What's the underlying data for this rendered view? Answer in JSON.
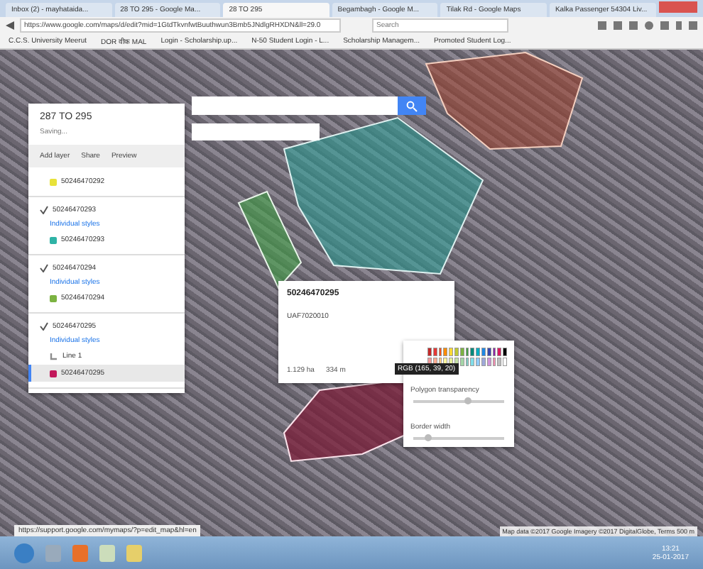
{
  "tabs": [
    {
      "label": "Inbox (2) - mayhataida...",
      "selected": false
    },
    {
      "label": "28 TO 295 - Google Ma...",
      "selected": false
    },
    {
      "label": "28 TO 295",
      "selected": true
    },
    {
      "label": "Begambagh - Google M...",
      "selected": false
    },
    {
      "label": "Tilak Rd - Google Maps",
      "selected": false
    },
    {
      "label": "Kalka Passenger 54304 Liv...",
      "selected": false
    }
  ],
  "address_bar": {
    "url": "https://www.google.com/maps/d/edit?mid=1GtdTkvnfwtBuuthwun3Bmb5JNdlgRHXDN&ll=29.0",
    "search_placeholder": "Search"
  },
  "bookmarks": [
    "C.C.S. University Meerut",
    "DOR वीक MAL",
    "Login - Scholarship.up...",
    "N-50 Student Login - L...",
    "Scholarship Managem...",
    "Promoted Student Log..."
  ],
  "map_panel": {
    "title": "287 TO 295",
    "status": "Saving...",
    "actions": [
      "Add layer",
      "Share",
      "Preview"
    ],
    "layers": [
      {
        "features": [
          {
            "label": "50246470292",
            "kind": "polygon",
            "color": "#e8e23a",
            "selected": false
          }
        ]
      },
      {
        "name": "50246470293",
        "checked": true,
        "style": "Individual styles",
        "features": [
          {
            "label": "50246470293",
            "kind": "polygon",
            "color": "#2fb3a6",
            "selected": false
          }
        ]
      },
      {
        "name": "50246470294",
        "checked": true,
        "style": "Individual styles",
        "features": [
          {
            "label": "50246470294",
            "kind": "polygon",
            "color": "#7cb342",
            "selected": false
          }
        ]
      },
      {
        "name": "50246470295",
        "checked": true,
        "style": "Individual styles",
        "features": [
          {
            "label": "Line 1",
            "kind": "line",
            "color": "#8d8d8d",
            "selected": false
          },
          {
            "label": "50246470295",
            "kind": "polygon",
            "color": "#c2185b",
            "selected": true
          }
        ]
      }
    ]
  },
  "info_popup": {
    "title": "50246470295",
    "description": "UAF7020010",
    "area": "1.129 ha",
    "perimeter": "334 m"
  },
  "color_picker": {
    "tooltip": "RGB (165, 39, 20)",
    "sliders": [
      {
        "label": "Polygon transparency",
        "level": 0.6
      },
      {
        "label": "Border width",
        "level": 0.15
      }
    ]
  },
  "status_link": "https://support.google.com/mymaps/?p=edit_map&hl=en",
  "map_credits": "Map data ©2017 Google Imagery ©2017 DigitalGlobe, Terms 500 m",
  "taskbar": {
    "time": "13:21",
    "date": "25-01-2017"
  }
}
